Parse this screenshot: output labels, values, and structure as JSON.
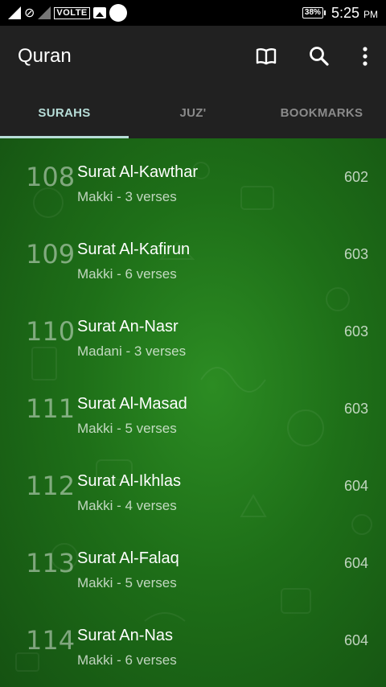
{
  "status_bar": {
    "network": "VOLTE",
    "battery": "38%",
    "time": "5:25",
    "ampm": "PM"
  },
  "appbar": {
    "title": "Quran",
    "icons": [
      "book-icon",
      "search-icon",
      "more-vert-icon"
    ]
  },
  "tabs": [
    {
      "label": "SURAHS",
      "active": true
    },
    {
      "label": "JUZ'",
      "active": false
    },
    {
      "label": "BOOKMARKS",
      "active": false
    }
  ],
  "surahs": [
    {
      "number": "108",
      "name": "Surat Al-Kawthar",
      "info": "Makki - 3 verses",
      "page": "602"
    },
    {
      "number": "109",
      "name": "Surat Al-Kafirun",
      "info": "Makki - 6 verses",
      "page": "603"
    },
    {
      "number": "110",
      "name": "Surat An-Nasr",
      "info": "Madani - 3 verses",
      "page": "603"
    },
    {
      "number": "111",
      "name": "Surat Al-Masad",
      "info": "Makki - 5 verses",
      "page": "603"
    },
    {
      "number": "112",
      "name": "Surat Al-Ikhlas",
      "info": "Makki - 4 verses",
      "page": "604"
    },
    {
      "number": "113",
      "name": "Surat Al-Falaq",
      "info": "Makki - 5 verses",
      "page": "604"
    },
    {
      "number": "114",
      "name": "Surat An-Nas",
      "info": "Makki - 6 verses",
      "page": "604"
    }
  ],
  "colors": {
    "accent": "#b7ddd8",
    "appbar": "#212121",
    "background_green": "#1e6f18"
  }
}
